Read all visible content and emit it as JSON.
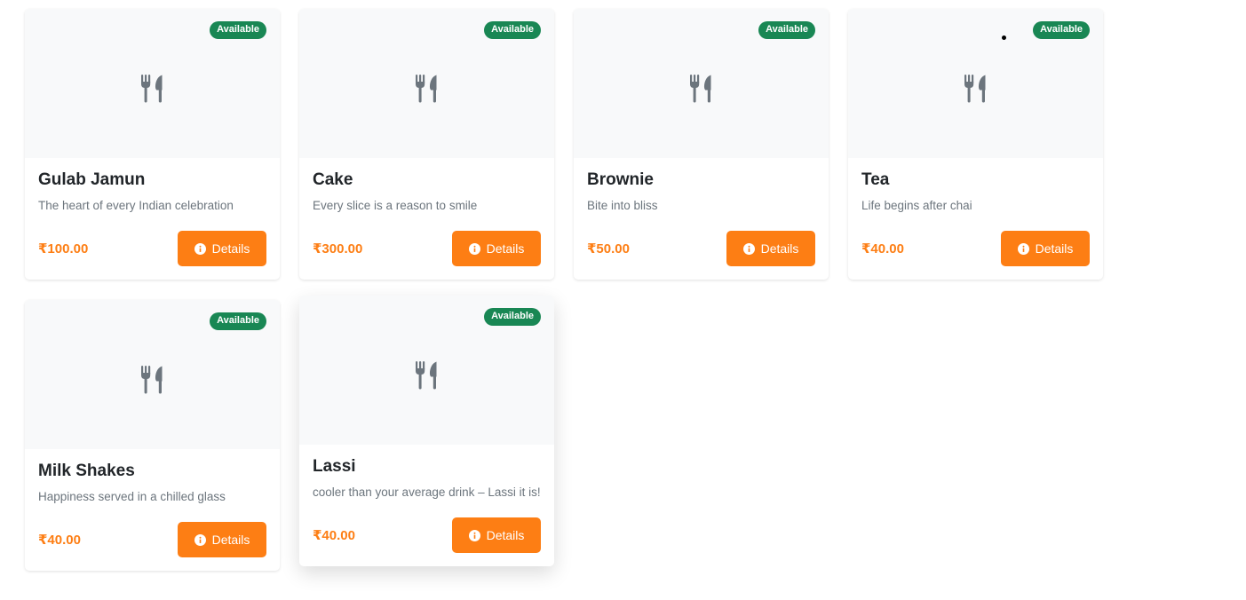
{
  "colors": {
    "accent": "#fd7e14",
    "available": "#198754",
    "image_bg": "#f8f9fa",
    "icon": "#6c757d"
  },
  "icons": {
    "image_placeholder": "utensils-icon",
    "button": "info-circle-icon"
  },
  "menu": {
    "items": [
      {
        "title": "Gulab Jamun",
        "description": "The heart of every Indian celebration",
        "price": "₹100.00",
        "status": "Available",
        "button_label": "Details"
      },
      {
        "title": "Cake",
        "description": "Every slice is a reason to smile",
        "price": "₹300.00",
        "status": "Available",
        "button_label": "Details"
      },
      {
        "title": "Brownie",
        "description": "Bite into bliss",
        "price": "₹50.00",
        "status": "Available",
        "button_label": "Details"
      },
      {
        "title": "Tea",
        "description": "Life begins after chai",
        "price": "₹40.00",
        "status": "Available",
        "button_label": "Details"
      },
      {
        "title": "Milk Shakes",
        "description": "Happiness served in a chilled glass",
        "price": "₹40.00",
        "status": "Available",
        "button_label": "Details"
      },
      {
        "title": "Lassi",
        "description": "cooler than your average drink – Lassi it is!",
        "price": "₹40.00",
        "status": "Available",
        "button_label": "Details"
      }
    ]
  }
}
